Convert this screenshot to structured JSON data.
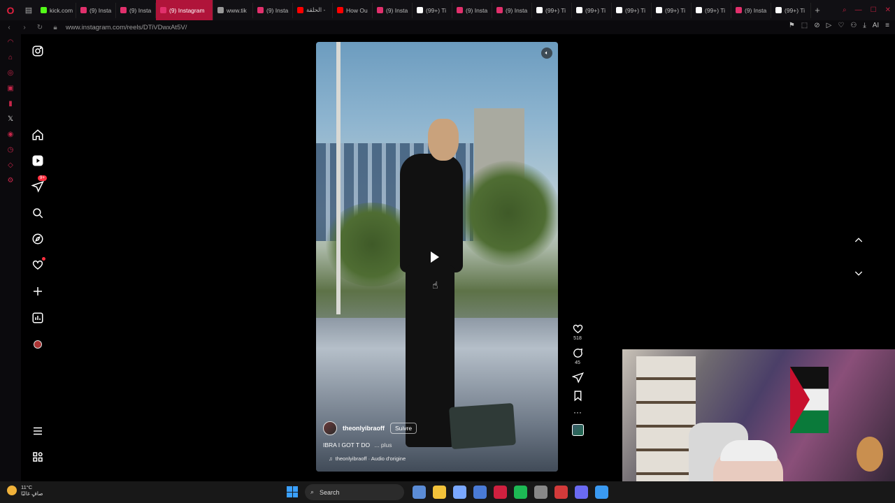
{
  "browser": {
    "logo": "O",
    "tabs": [
      {
        "label": "kick.com",
        "color": "#53fc18",
        "active": false
      },
      {
        "label": "(9) Insta",
        "color": "#e1306c",
        "active": false
      },
      {
        "label": "(9) Insta",
        "color": "#e1306c",
        "active": false
      },
      {
        "label": "(9) Instagram",
        "color": "#e1306c",
        "active": true
      },
      {
        "label": "www.tik",
        "color": "#999999",
        "active": false
      },
      {
        "label": "(9) Insta",
        "color": "#e1306c",
        "active": false
      },
      {
        "label": "الحلقة -",
        "color": "#ff0000",
        "active": false
      },
      {
        "label": "How Ou",
        "color": "#ff0000",
        "active": false
      },
      {
        "label": "(9) Insta",
        "color": "#e1306c",
        "active": false
      },
      {
        "label": "(99+) Ti",
        "color": "#ffffff",
        "active": false
      },
      {
        "label": "(9) Insta",
        "color": "#e1306c",
        "active": false
      },
      {
        "label": "(9) Insta",
        "color": "#e1306c",
        "active": false
      },
      {
        "label": "(99+) Ti",
        "color": "#ffffff",
        "active": false
      },
      {
        "label": "(99+) Ti",
        "color": "#ffffff",
        "active": false
      },
      {
        "label": "(99+) Ti",
        "color": "#ffffff",
        "active": false
      },
      {
        "label": "(99+) Ti",
        "color": "#ffffff",
        "active": false
      },
      {
        "label": "(99+) Ti",
        "color": "#ffffff",
        "active": false
      },
      {
        "label": "(9) Insta",
        "color": "#e1306c",
        "active": false
      },
      {
        "label": "(99+) Ti",
        "color": "#ffffff",
        "active": false
      }
    ],
    "new_tab": "+",
    "url": "www.instagram.com/reels/DTiVDwxAt5V/",
    "ai_label": "AI"
  },
  "instagram": {
    "notif_badge": "9+",
    "reel": {
      "username": "theonlyibraoff",
      "follow_label": "Suivre",
      "caption": "IBRA I GOT T DO",
      "more_label": "... plus",
      "audio": "theonlyibraoff · Audio d'origine"
    },
    "actions": {
      "likes": "518",
      "comments": "45"
    }
  },
  "taskbar": {
    "temperature": "11°C",
    "weather_desc": "صافٍ غالبًا",
    "search_label": "Search",
    "icon_colors": [
      "#5b8cd6",
      "#f2c23a",
      "#7aa8ff",
      "#4a7bd6",
      "#d0203f",
      "#1db954",
      "#888888",
      "#d33a3a",
      "#6a6af2",
      "#3a9af2"
    ]
  },
  "colors": {
    "opera_red": "#c8264a",
    "active_tab": "#b0143a"
  }
}
